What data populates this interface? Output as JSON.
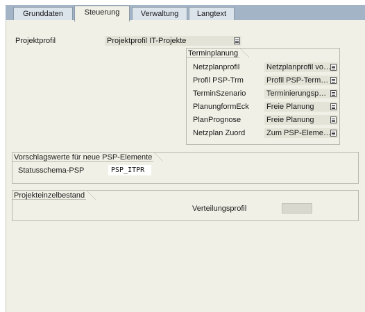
{
  "tabs": [
    {
      "label": "Grunddaten",
      "active": false
    },
    {
      "label": "Steuerung",
      "active": true
    },
    {
      "label": "Verwaltung",
      "active": false
    },
    {
      "label": "Langtext",
      "active": false
    }
  ],
  "projektprofil": {
    "label": "Projektprofil",
    "value": "Projektprofil IT-Projekte"
  },
  "terminplanung": {
    "title": "Terminplanung",
    "rows": [
      {
        "label": "Netzplanprofil",
        "value": "Netzplanprofil vo…"
      },
      {
        "label": "Profil PSP-Trm",
        "value": "Profil PSP-Term…"
      },
      {
        "label": "TerminSzenario",
        "value": "Terminierungsp…"
      },
      {
        "label": "PlanungformEck",
        "value": "Freie Planung"
      },
      {
        "label": "PlanPrognose",
        "value": "Freie Planung"
      },
      {
        "label": "Netzplan Zuord",
        "value": "Zum PSP-Eleme…"
      }
    ]
  },
  "vorschlagswerte": {
    "title": "Vorschlagswerte für neue PSP-Elemente",
    "statusschema_label": "Statusschema-PSP",
    "statusschema_value": "PSP_ITPR"
  },
  "projekteinzelbestand": {
    "title": "Projekteinzelbestand",
    "verteilungsprofil_label": "Verteilungsprofil",
    "verteilungsprofil_value": ""
  },
  "colors": {
    "tabstrip": "#a3b4c6",
    "panel": "#f0f0e6",
    "readonly_field": "#e4e3d8"
  }
}
